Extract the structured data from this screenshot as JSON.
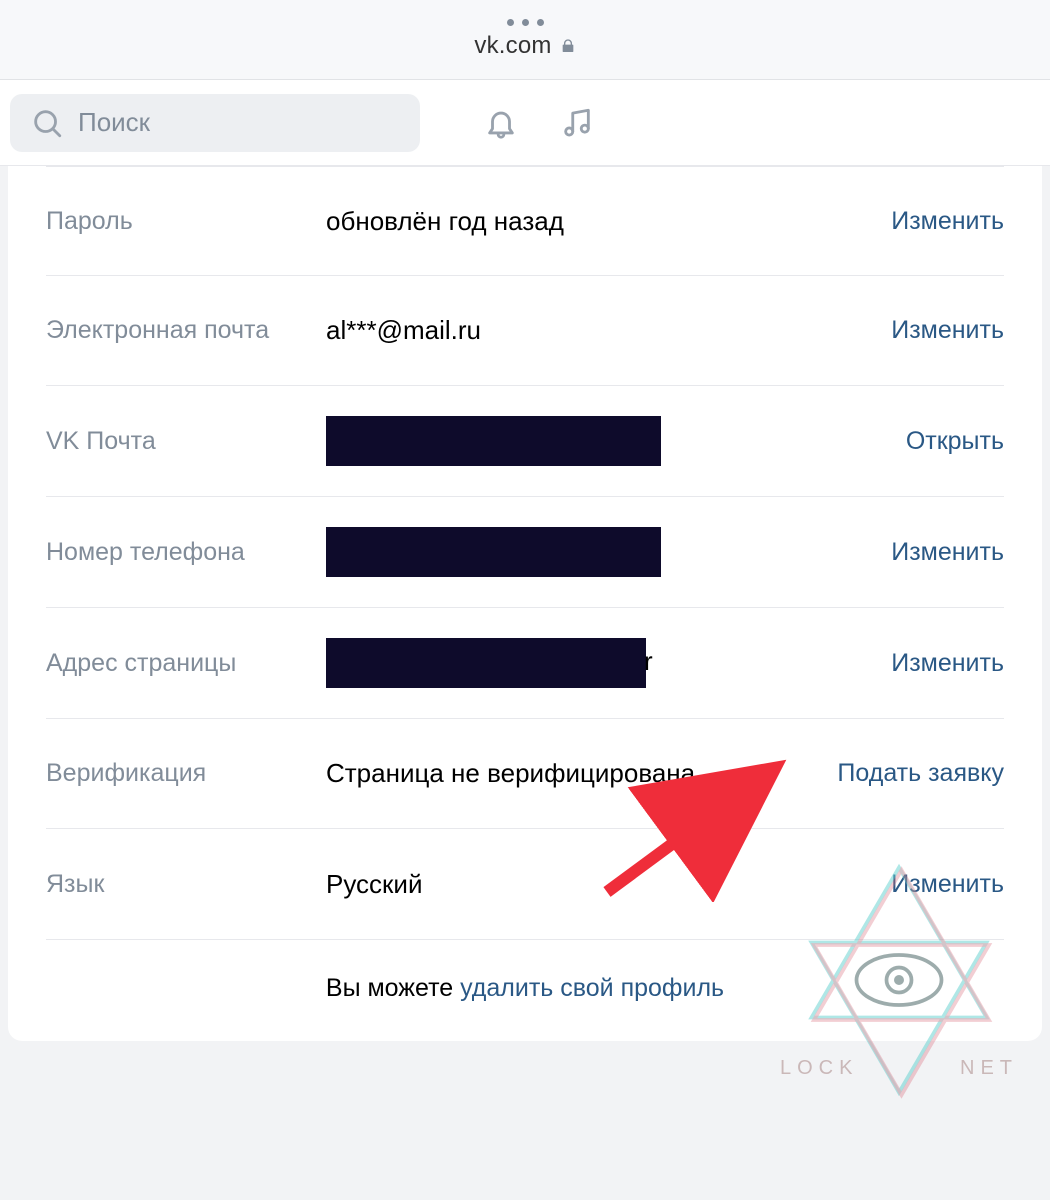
{
  "browser": {
    "domain": "vk.com"
  },
  "header": {
    "search_placeholder": "Поиск"
  },
  "rows": {
    "password": {
      "label": "Пароль",
      "value": "обновлён год назад",
      "action": "Изменить"
    },
    "email": {
      "label": "Электронная почта",
      "value": "al***@mail.ru",
      "action": "Изменить"
    },
    "vkmail": {
      "label": "VK Почта",
      "action": "Открыть"
    },
    "phone": {
      "label": "Номер телефона",
      "action": "Изменить"
    },
    "pageaddr": {
      "label": "Адрес страницы",
      "fragment": "r",
      "action": "Изменить"
    },
    "verify": {
      "label": "Верификация",
      "value": "Страница не верифицирована",
      "action": "Подать заявку"
    },
    "language": {
      "label": "Язык",
      "value": "Русский",
      "action": "Изменить"
    }
  },
  "footer": {
    "prefix": "Вы можете ",
    "link": "удалить свой профиль"
  },
  "watermark": {
    "left": "LOCK",
    "right": "NET"
  }
}
